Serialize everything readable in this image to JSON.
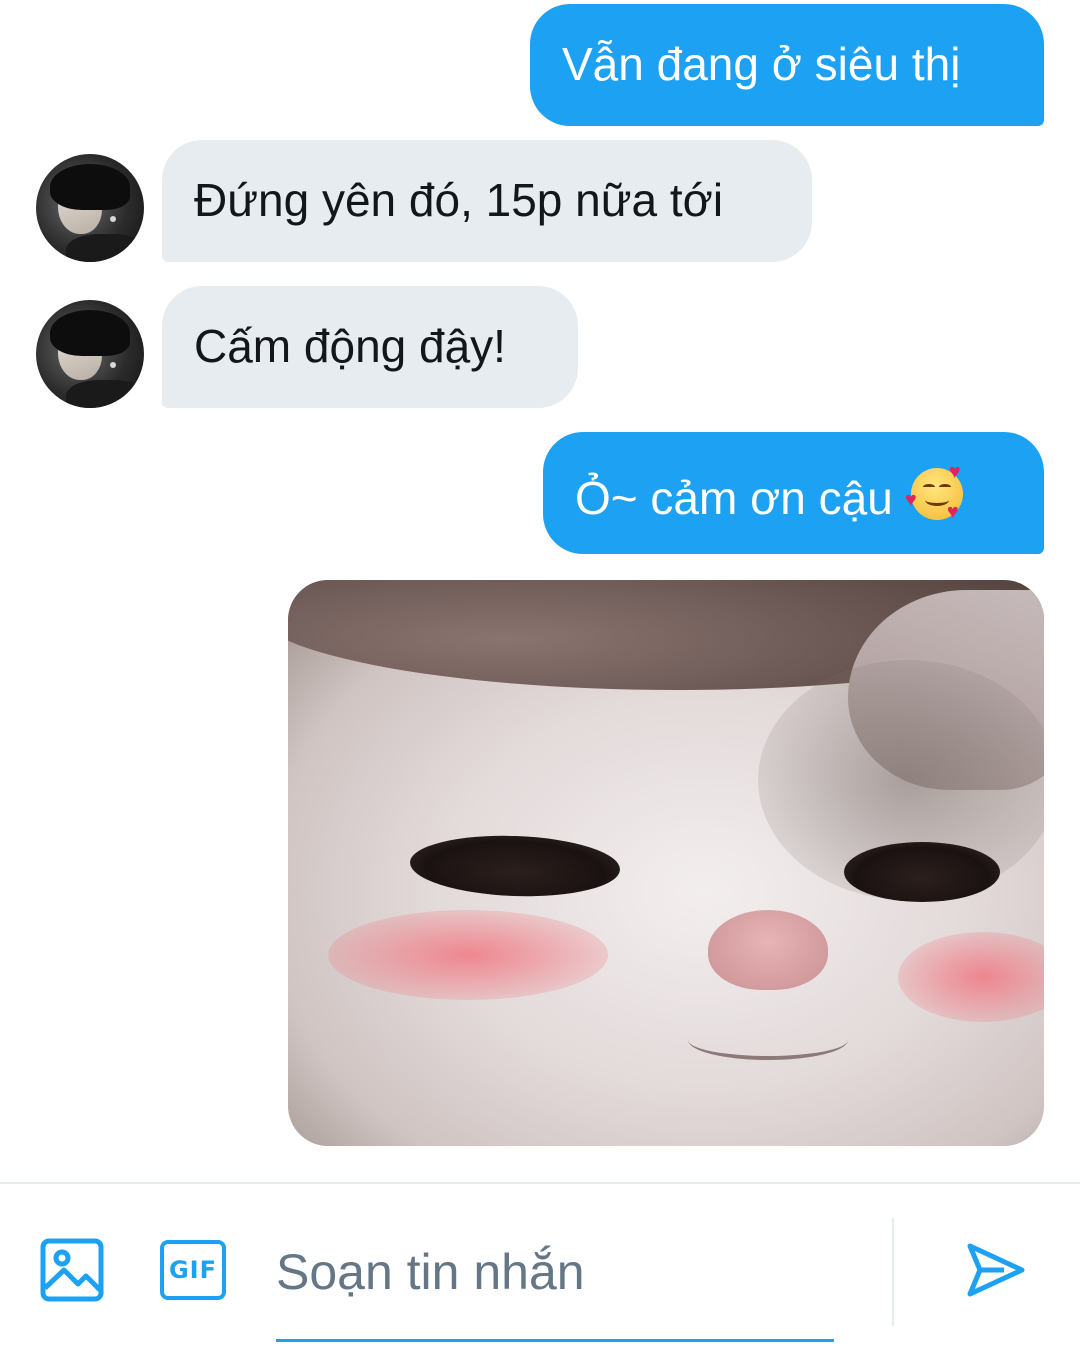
{
  "messages": [
    {
      "direction": "out",
      "text": "Vẫn đang ở siêu thị"
    },
    {
      "direction": "in",
      "text": "Đứng yên đó, 15p nữa tới"
    },
    {
      "direction": "in",
      "text": "Cấm động đậy!"
    },
    {
      "direction": "out",
      "text": "Ỏ~ cảm ơn cậu",
      "emoji": "smiling-face-with-hearts"
    },
    {
      "direction": "out",
      "type": "image",
      "image": "cat-photo"
    }
  ],
  "composer": {
    "placeholder": "Soạn tin nhắn",
    "image_icon": "image-icon",
    "gif_label": "GIF",
    "send_icon": "send-icon"
  },
  "colors": {
    "accent": "#1da1f2",
    "incoming_bubble": "#e6ecf0",
    "placeholder": "#657786"
  }
}
